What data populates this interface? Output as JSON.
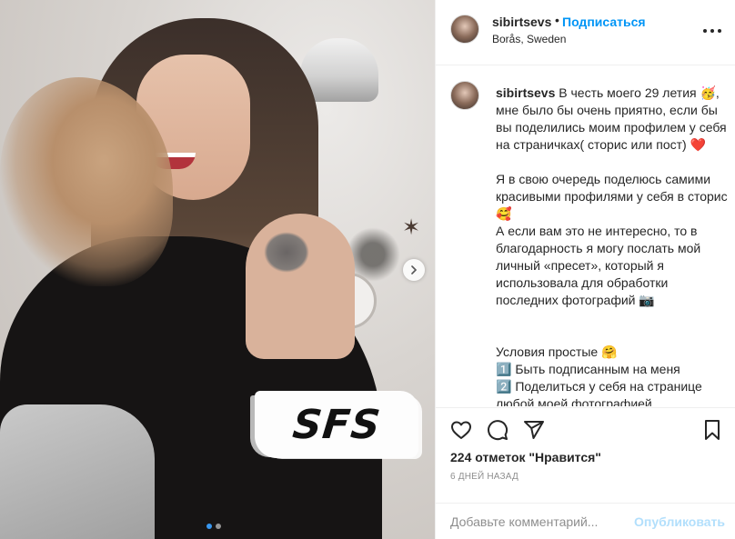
{
  "post": {
    "photo": {
      "overlay_text": "SFS",
      "carousel_count": 2,
      "carousel_active": 1
    },
    "header": {
      "username": "sibirtsevs",
      "separator": "•",
      "follow_label": "Подписаться",
      "location": "Borås, Sweden"
    },
    "caption": {
      "username": "sibirtsevs",
      "text": " В честь моего 29 летия 🥳, мне было бы очень приятно, если бы вы поделились моим профилем у себя на страничках( сторис или пост) ❤️\n\nЯ в свою очередь поделюсь самими красивыми профилями у себя в сторис 🥰\nА если вам это не интересно, то в благодарность я могу послать мой личный «пресет», который я использовала для обработки последних фотографий 📷\n\n\nУсловия простые 🤗\n1️⃣ Быть подписанным на меня\n2️⃣ Поделиться у себя на странице любой моей фотографией"
    },
    "actions": {
      "icons": [
        "heart-icon",
        "comment-icon",
        "share-icon",
        "bookmark-icon"
      ],
      "likes": "224 отметок \"Нравится\"",
      "time": "6 ДНЕЙ НАЗАД"
    },
    "comment_box": {
      "placeholder": "Добавьте комментарий...",
      "post_label": "Опубликовать"
    },
    "colors": {
      "link": "#0095f6",
      "post_disabled": "#b2dffc",
      "muted": "#8e8e8e",
      "carousel_active": "#3897f0"
    }
  }
}
